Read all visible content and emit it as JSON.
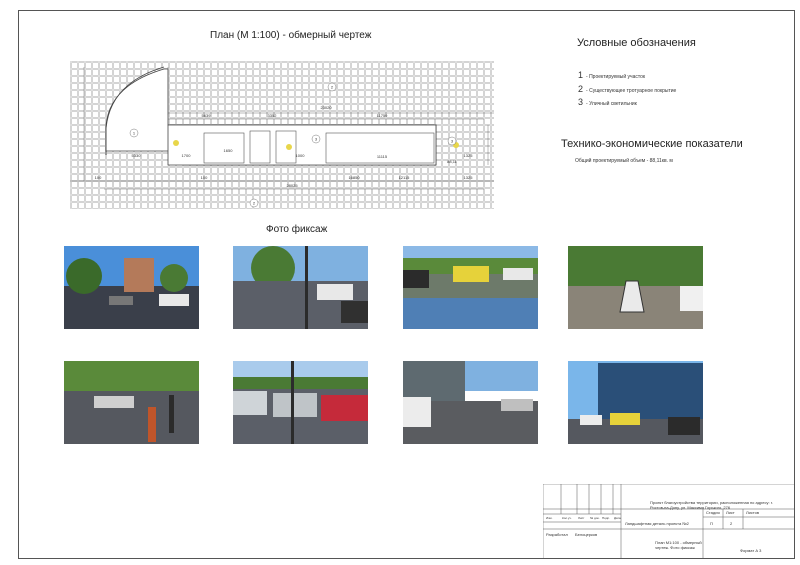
{
  "plan": {
    "title": "План (М 1:100) - обмерный чертеж",
    "dims": [
      "5639",
      "3352",
      "11759",
      "23020",
      "5330",
      "1700",
      "1650",
      "1000",
      "1000",
      "1700",
      "11115",
      "1325",
      "16850",
      "12115",
      "1325",
      "28025",
      "100",
      "100",
      "100",
      "4490",
      "3750",
      "2750",
      "4490",
      "4490",
      "6490",
      "2650",
      "88,11",
      "1100",
      "2850"
    ],
    "markers": [
      "1",
      "2",
      "3",
      "3"
    ]
  },
  "legend": {
    "title": "Условные обозначения",
    "items": [
      {
        "num": "1",
        "text": "Проектируемый участок"
      },
      {
        "num": "2",
        "text": "Существующее тротуарное покрытие"
      },
      {
        "num": "3",
        "text": "Уличный светильник"
      }
    ]
  },
  "tep": {
    "title": "Технико-экономические показатели",
    "text": "Общий проектируемый объем - 88,11кв. м"
  },
  "photos": {
    "title": "Фото фиксаж",
    "items": [
      {
        "name": "photo-1"
      },
      {
        "name": "photo-2"
      },
      {
        "name": "photo-3"
      },
      {
        "name": "photo-4"
      },
      {
        "name": "photo-5"
      },
      {
        "name": "photo-6"
      },
      {
        "name": "photo-7"
      },
      {
        "name": "photo-8"
      }
    ]
  },
  "title_block": {
    "project": "Проект благоустройства территории, расположенная по адресу: г. Ростов-на-Дону, ул. Максима Горького, 276",
    "sheet_name": "Ландшафтная деталь проекта №2",
    "stage_h": "Стадия",
    "sheet_h": "Лист",
    "sheets_h": "Листов",
    "stage_v": "П",
    "sheet_v": "2",
    "content": "План М1:100 - обмерный чертеж. Фото фиксаж",
    "format": "Формат А 3",
    "left_cols": [
      "Изм.",
      "Кол.уч.",
      "Лист",
      "№ док.",
      "Подп.",
      "Дата"
    ],
    "developer_role": "Разработал",
    "developer_name": "Белоцерков"
  },
  "colors": {
    "line": "#555555",
    "grid": "#999999",
    "accent_yellow": "#e8d64a"
  }
}
